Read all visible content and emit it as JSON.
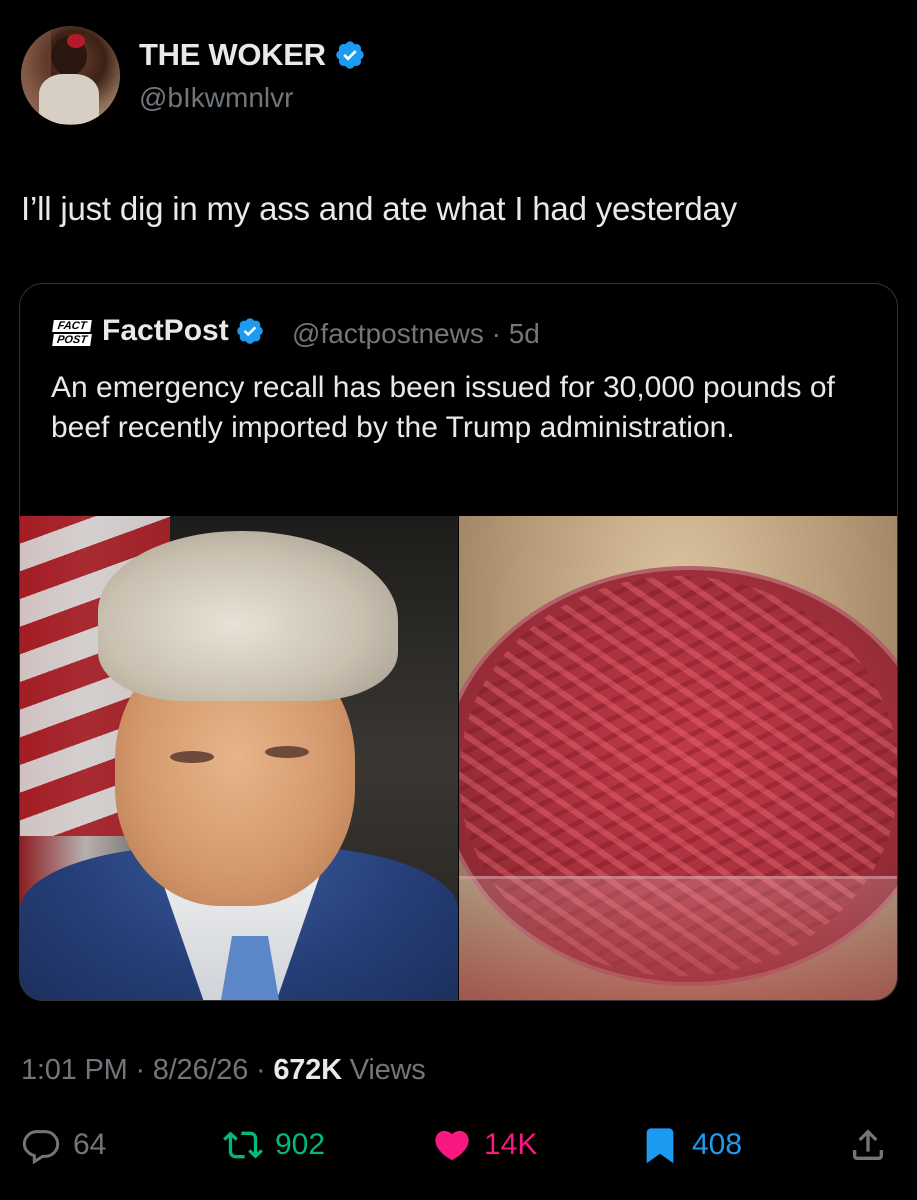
{
  "author": {
    "display_name": "THE WOKER",
    "handle": "@bIkwmnlvr",
    "verified_icon": "verified-badge-icon"
  },
  "tweet": {
    "text": "I’ll just dig in my ass and ate what I had yesterday"
  },
  "quote": {
    "logo_line1": "FACT",
    "logo_line2": "POST",
    "display_name": "FactPost",
    "handle_time": "@factpostnews · 5d",
    "text": "An emergency recall has been issued for 30,000 pounds of beef recently imported by the Trump administration."
  },
  "meta": {
    "time": "1:01 PM · 8/26/26 · ",
    "views_count": "672K",
    "views_label": " Views"
  },
  "actions": {
    "replies": "64",
    "reposts": "902",
    "likes": "14K",
    "bookmarks": "408"
  },
  "colors": {
    "background": "#000000",
    "text": "#e7e9ea",
    "secondary": "#71767b",
    "verified": "#1d9bf0",
    "repost": "#00ba7c",
    "like": "#f91880",
    "bookmark": "#1d9bf0"
  }
}
